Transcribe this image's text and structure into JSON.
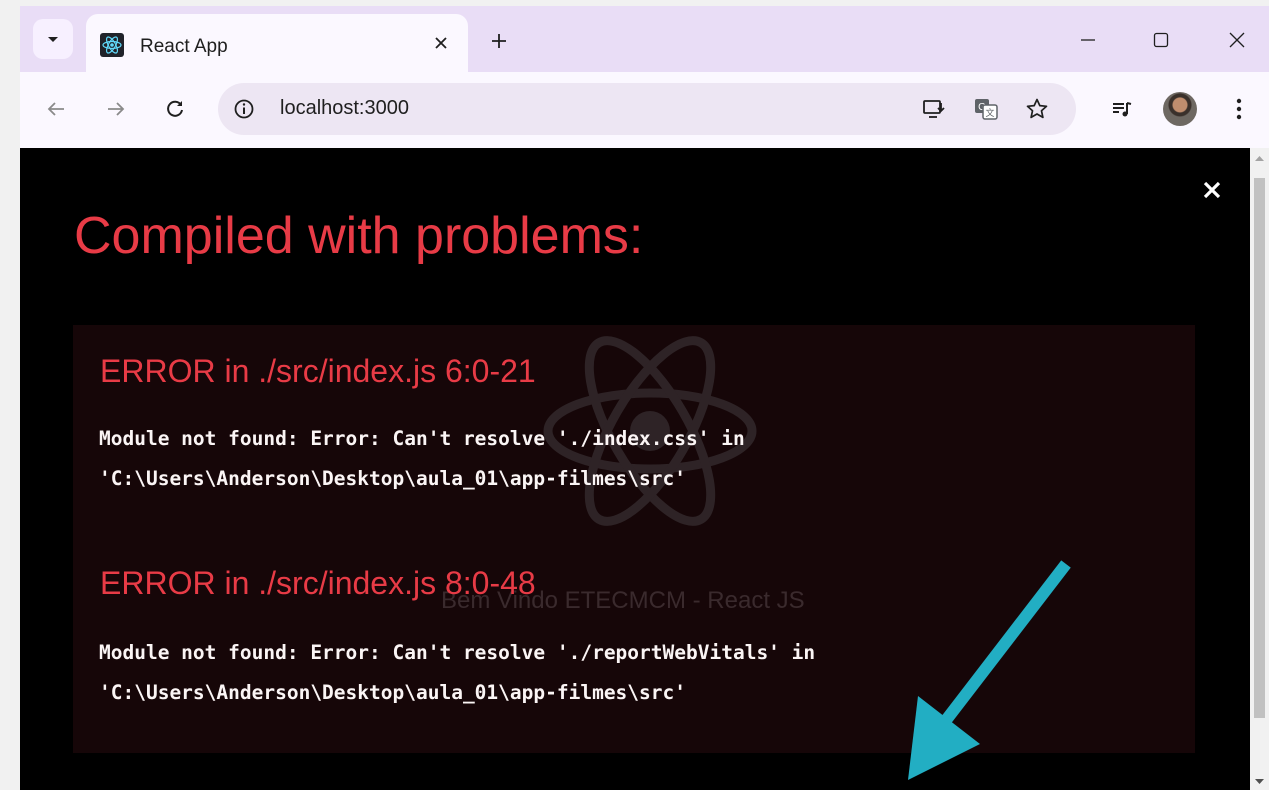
{
  "tab": {
    "title": "React App"
  },
  "address_bar": {
    "url": "localhost:3000"
  },
  "overlay": {
    "title": "Compiled with problems:",
    "errors": [
      {
        "heading": "ERROR in ./src/index.js 6:0-21",
        "line1": "Module not found: Error: Can't resolve './index.css' in",
        "line2": "'C:\\Users\\Anderson\\Desktop\\aula_01\\app-filmes\\src'"
      },
      {
        "heading": "ERROR in ./src/index.js 8:0-48",
        "line1": "Module not found: Error: Can't resolve './reportWebVitals' in",
        "line2": "'C:\\Users\\Anderson\\Desktop\\aula_01\\app-filmes\\src'"
      }
    ]
  },
  "background_page": {
    "caption": "Bem Vindo ETECMCM - React JS"
  },
  "colors": {
    "error_red": "#e83b46",
    "arrow_teal": "#22aec3",
    "tabstrip": "#e9ddf6",
    "toolbar": "#fbf8ff"
  },
  "icons": {
    "tab_menu": "chevron-down-icon",
    "favicon": "react-logo-icon",
    "tab_close": "close-icon",
    "new_tab": "plus-icon",
    "minimize": "minimize-icon",
    "maximize": "maximize-icon",
    "close_window": "close-icon",
    "back": "arrow-left-icon",
    "forward": "arrow-right-icon",
    "reload": "reload-icon",
    "site_info": "info-icon",
    "install_app": "install-icon",
    "translate": "translate-icon",
    "bookmark": "star-icon",
    "media": "media-queue-icon",
    "menu": "kebab-menu-icon"
  }
}
